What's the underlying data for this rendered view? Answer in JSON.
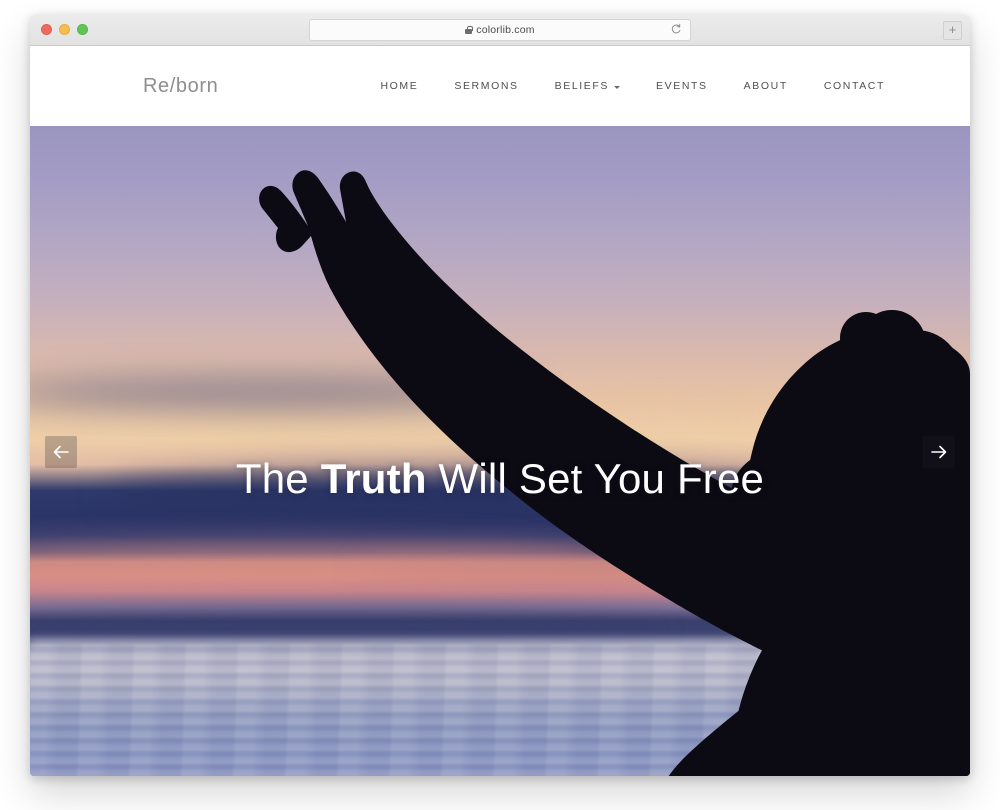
{
  "browser": {
    "url": "colorlib.com",
    "lock_icon": "lock-icon",
    "reload_icon": "reload-icon",
    "new_tab_label": "+",
    "traffic_lights": [
      "close-red",
      "minimize-yellow",
      "zoom-green"
    ]
  },
  "site": {
    "logo": "Re/born",
    "nav": [
      {
        "label": "HOME",
        "has_dropdown": false
      },
      {
        "label": "SERMONS",
        "has_dropdown": false
      },
      {
        "label": "BELIEFS",
        "has_dropdown": true
      },
      {
        "label": "EVENTS",
        "has_dropdown": false
      },
      {
        "label": "ABOUT",
        "has_dropdown": false
      },
      {
        "label": "CONTACT",
        "has_dropdown": false
      }
    ]
  },
  "hero": {
    "title_part1": "The ",
    "title_strong": "Truth",
    "title_part2": " Will Set You Free",
    "full_title": "The Truth Will Set You Free",
    "prev_label": "←",
    "next_label": "→",
    "image_alt": "silhouette of a woman with arm raised at sunset over the sea"
  },
  "colors": {
    "header_bg": "#ffffff",
    "nav_text": "#4f4f4f",
    "logo_text": "#8e8e8e",
    "sky_top": "#9a95c0",
    "sky_warm": "#eecfa8",
    "cloud_dark": "#2f3a6b",
    "cloud_pink": "#d88f84",
    "water": "#9199c2",
    "hero_text": "#ffffff",
    "arrow_bg": "rgba(30,30,40,0.25)"
  }
}
